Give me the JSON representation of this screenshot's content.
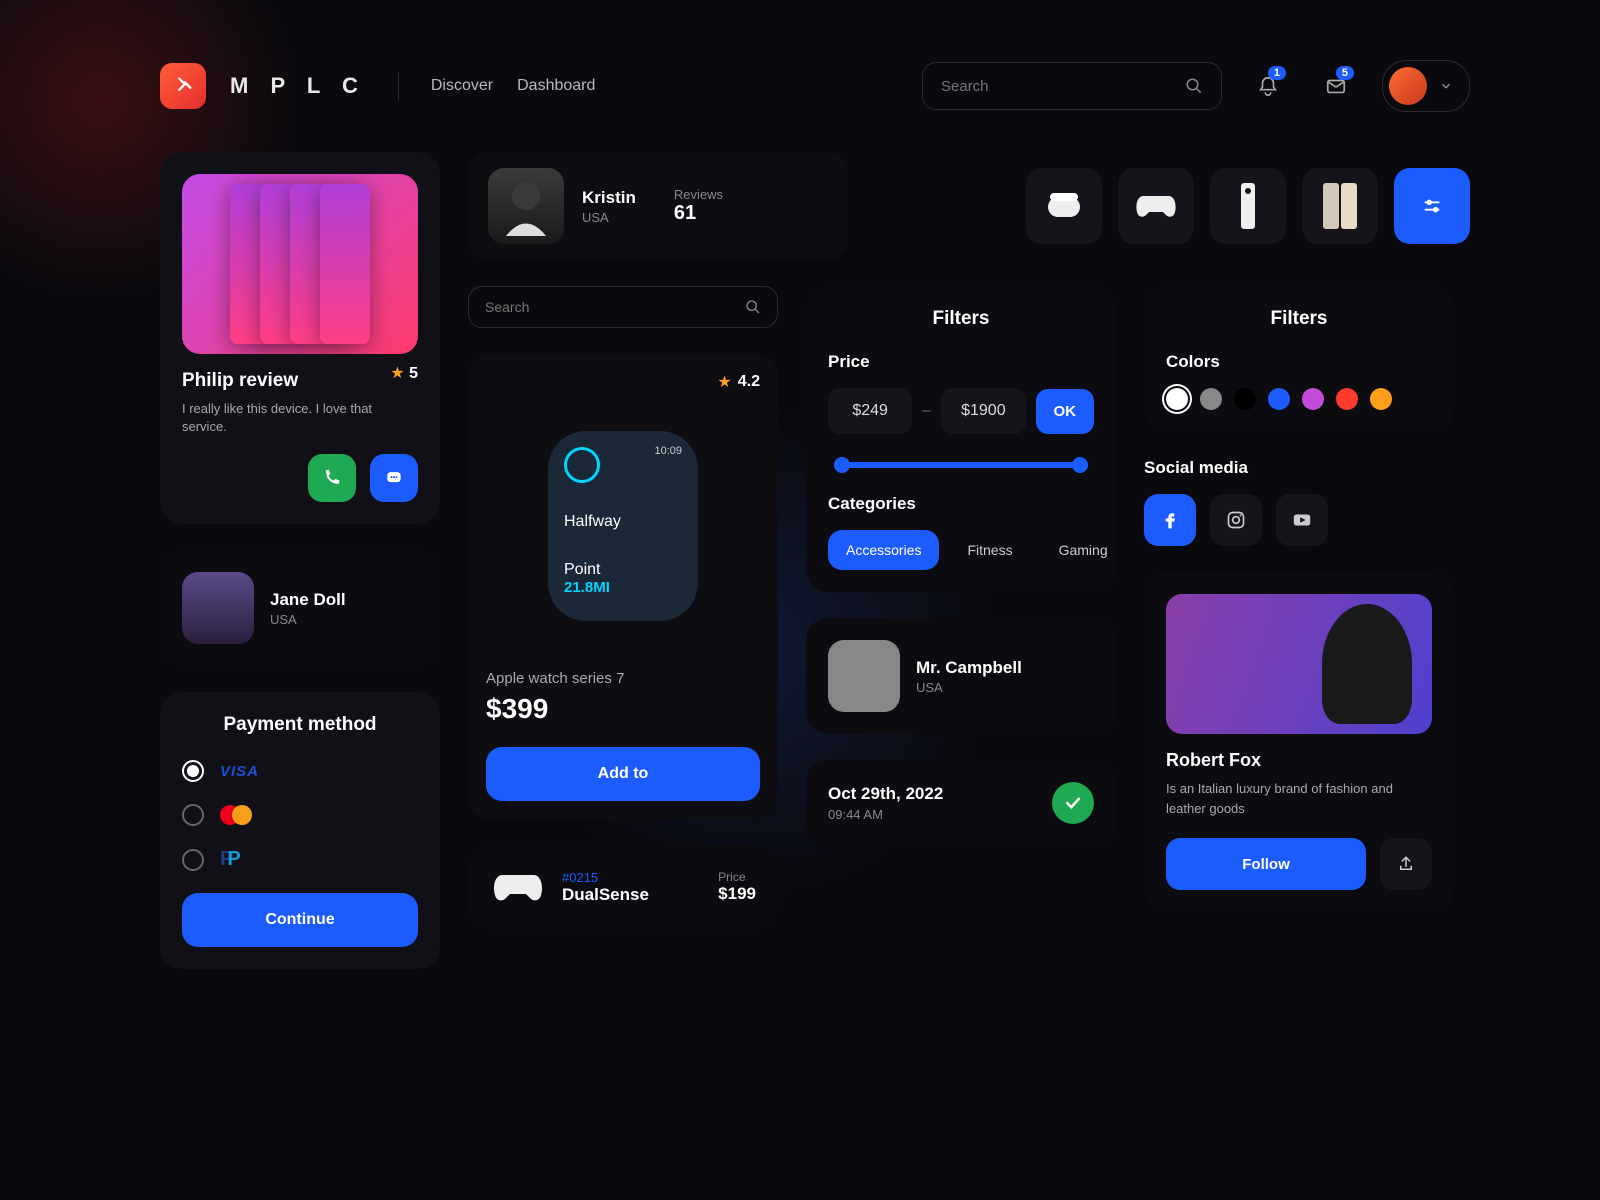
{
  "header": {
    "brand": "M P L C",
    "nav": {
      "discover": "Discover",
      "dashboard": "Dashboard"
    },
    "search_placeholder": "Search",
    "notif_badge": "1",
    "mail_badge": "5"
  },
  "review_card": {
    "title": "Philip review",
    "rating": "5",
    "text": "I really like this device. I love that service."
  },
  "jane": {
    "name": "Jane Doll",
    "loc": "USA"
  },
  "payment": {
    "title": "Payment method",
    "visa": "VISA",
    "continue": "Continue"
  },
  "kristin": {
    "name": "Kristin",
    "loc": "USA",
    "reviews_label": "Reviews",
    "reviews": "61"
  },
  "search2_placeholder": "Search",
  "watch": {
    "rating": "4.2",
    "time": "10:09",
    "line1": "Halfway",
    "line2": "Point",
    "miles": "21.8MI",
    "name": "Apple watch series 7",
    "price": "$399",
    "add": "Add to"
  },
  "dual": {
    "id": "#0215",
    "name": "DualSense",
    "price_label": "Price",
    "price": "$199"
  },
  "filters": {
    "title": "Filters",
    "price_label": "Price",
    "min": "$249",
    "max": "$1900",
    "ok": "OK",
    "cat_label": "Categories",
    "cats": {
      "a": "Accessories",
      "b": "Fitness",
      "c": "Gaming"
    }
  },
  "campbell": {
    "name": "Mr. Campbell",
    "loc": "USA"
  },
  "order": {
    "date": "Oct 29th, 2022",
    "time": "09:44 AM"
  },
  "filters2": {
    "title": "Filters",
    "colors_label": "Colors"
  },
  "colors": [
    "#ffffff",
    "#888888",
    "#000000",
    "#1c5cff",
    "#c44bd9",
    "#ff3a2e",
    "#ff9f1c"
  ],
  "social": {
    "title": "Social media"
  },
  "fox": {
    "name": "Robert Fox",
    "desc": "Is an Italian luxury brand of fashion and leather goods",
    "follow": "Follow"
  }
}
